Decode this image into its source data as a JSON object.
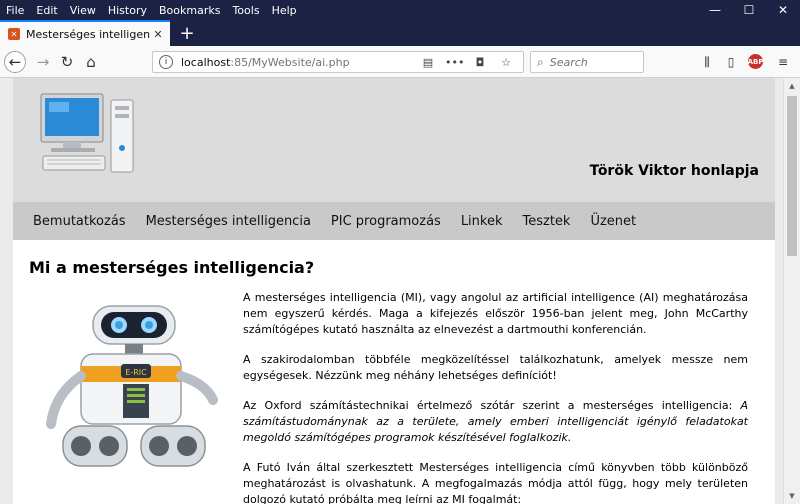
{
  "menu": {
    "items": [
      "File",
      "Edit",
      "View",
      "History",
      "Bookmarks",
      "Tools",
      "Help"
    ]
  },
  "window_controls": {
    "minimize": "—",
    "maximize": "☐",
    "close": "✕"
  },
  "tab": {
    "title": "Mesterséges intelligencia",
    "close": "✕",
    "favicon": "xampp-icon"
  },
  "newtab": "+",
  "url": {
    "host": "localhost",
    "rest": ":85/MyWebsite/ai.php"
  },
  "search": {
    "placeholder": "Search"
  },
  "site": {
    "title": "Török Viktor honlapja",
    "nav": [
      "Bemutatkozás",
      "Mesterséges intelligencia",
      "PIC programozás",
      "Linkek",
      "Tesztek",
      "Üzenet"
    ]
  },
  "article": {
    "heading": "Mi a mesterséges intelligencia?",
    "p1": "A mesterséges intelligencia (MI), vagy angolul az artificial intelligence (AI) meghatározása nem egyszerű kérdés. Maga a kifejezés először 1956-ban jelent meg, John McCarthy számítógépes kutató használta az elnevezést a dartmouthi konferencián.",
    "p2": "A szakirodalomban többféle megközelítéssel találkozhatunk, amelyek messze nem egységesek. Nézzünk meg néhány lehetséges definíciót!",
    "p3_plain": "Az Oxford számítástechnikai értelmező szótár szerint a mesterséges intelligencia: ",
    "p3_italic": "A számítástudománynak az a területe, amely emberi intelligenciát igénylő feladatokat megoldó számítógépes programok készítésével foglalkozik.",
    "p4": "A Futó Iván által szerkesztett Mesterséges intelligencia című könyvben több különböző meghatározást is olvashatunk. A megfogalmazás módja attól függ, hogy mely területen dolgozó kutató próbálta meg leírni az MI fogalmát:"
  },
  "robot_badge": "E-RIC"
}
